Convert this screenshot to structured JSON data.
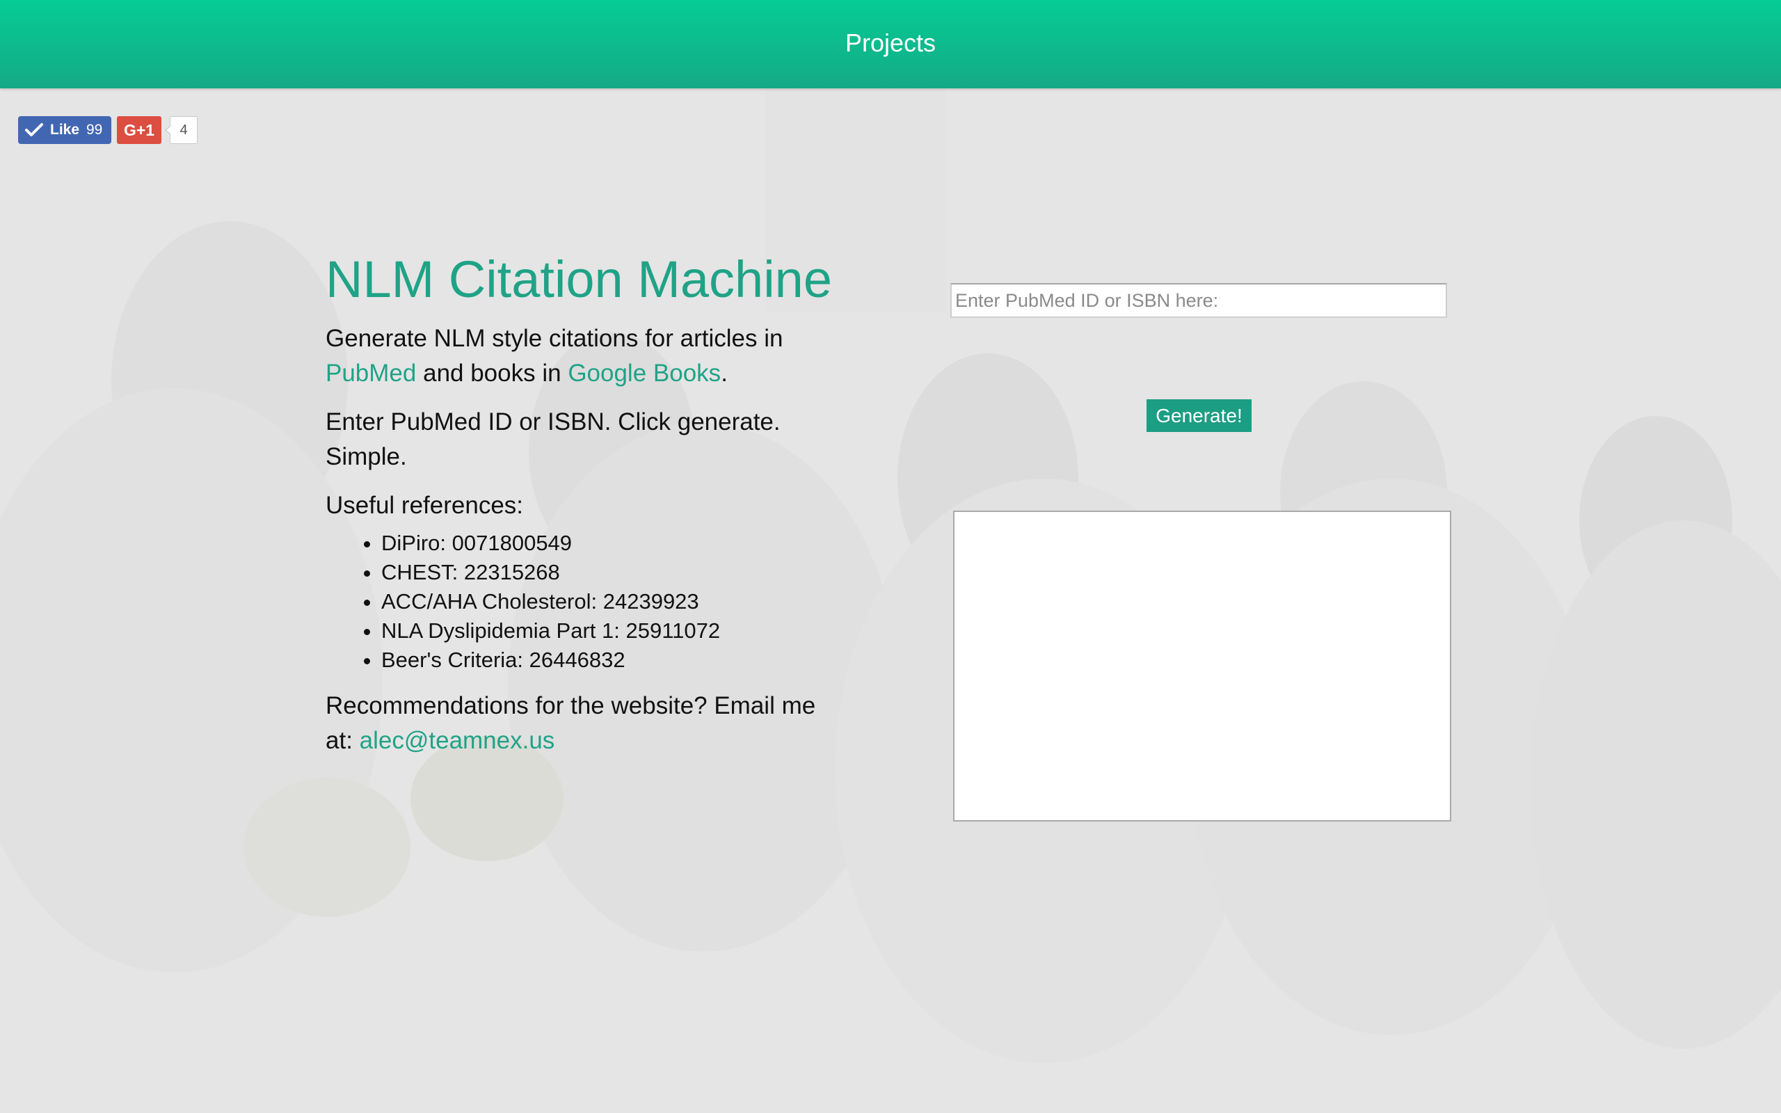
{
  "header": {
    "title": "Projects"
  },
  "social": {
    "like_label": "Like",
    "like_count": "99",
    "gplus_label": "G+1",
    "gplus_count": "4"
  },
  "main": {
    "title": "NLM Citation Machine",
    "intro_text_1": "Generate NLM style citations for articles in ",
    "pubmed_link": "PubMed",
    "intro_text_2": " and books in ",
    "google_books_link": "Google Books",
    "intro_text_3": ".",
    "instructions": "Enter PubMed ID or ISBN. Click generate. Simple.",
    "references_heading": "Useful references:",
    "references": [
      "DiPiro: 0071800549",
      "CHEST: 22315268",
      "ACC/AHA Cholesterol: 24239923",
      "NLA Dyslipidemia Part 1: 25911072",
      "Beer's Criteria: 26446832"
    ],
    "contact_text": "Recommendations for the website? Email me at: ",
    "contact_email": "alec@teamnex.us"
  },
  "form": {
    "input_placeholder": "Enter PubMed ID or ISBN here:",
    "input_value": "",
    "generate_label": "Generate!",
    "output_value": ""
  },
  "colors": {
    "header_top": "#05cc94",
    "header_bottom": "#15aa87",
    "accent": "#1fa387",
    "button": "#1c9e84",
    "background": "#e6e6e6"
  }
}
